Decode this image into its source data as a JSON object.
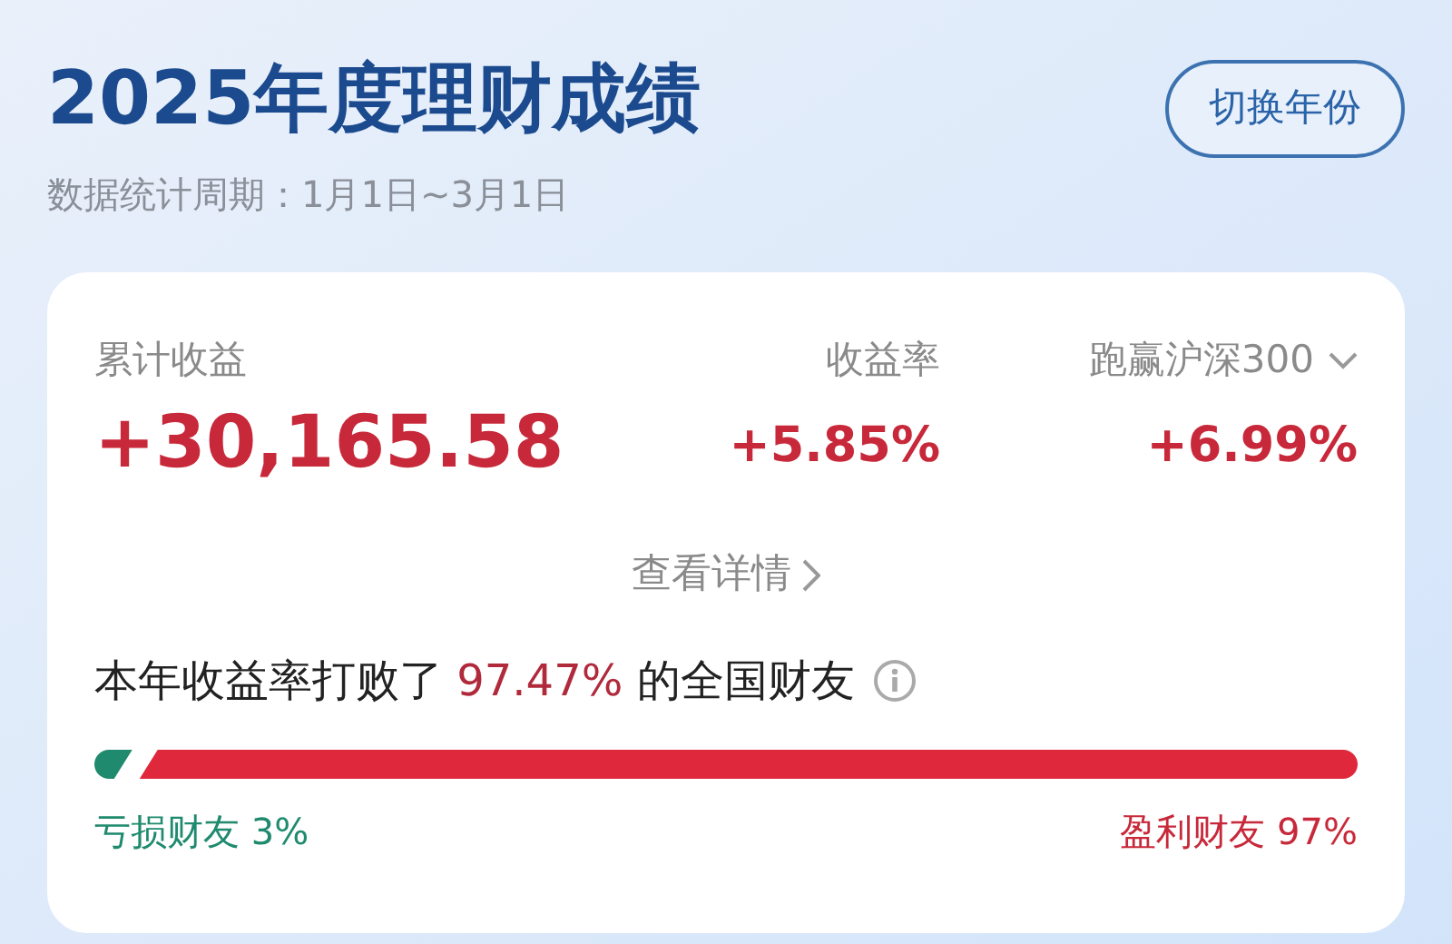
{
  "header": {
    "title": "2025年度理财成绩",
    "period": "数据统计周期：1月1日~3月1日",
    "switch_button": "切换年份"
  },
  "summary": {
    "metrics": [
      {
        "label": "累计收益",
        "value": "+30,165.58",
        "kind": "main",
        "dropdown": false
      },
      {
        "label": "收益率",
        "value": "+5.85%",
        "kind": "minor",
        "dropdown": false
      },
      {
        "label": "跑赢沪深300",
        "value": "+6.99%",
        "kind": "minor",
        "dropdown": true
      }
    ],
    "details_link": "查看详情",
    "ranking": {
      "before": "本年收益率打败了",
      "highlight": "97.47%",
      "after": "的全国财友"
    },
    "distribution": {
      "level": 0.03,
      "loss_label": "亏损财友 3%",
      "profit_label": "盈利财友 97%"
    }
  }
}
